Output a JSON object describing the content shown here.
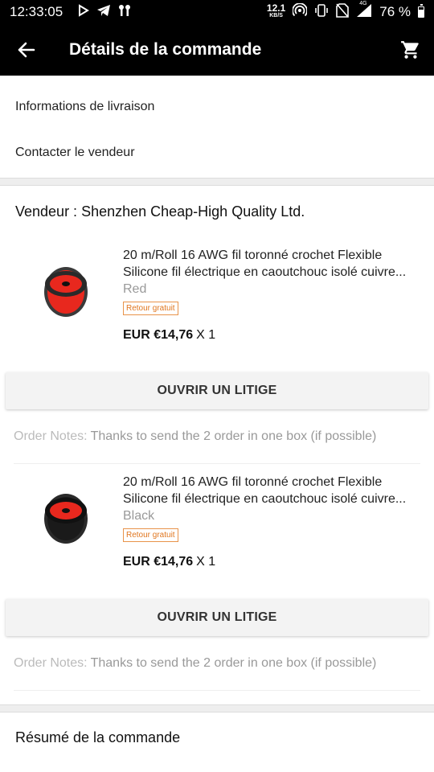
{
  "status_bar": {
    "time": "12:33:05",
    "speed_value": "12.1",
    "speed_unit": "KB/S",
    "network": "4G",
    "battery": "76 %"
  },
  "app_bar": {
    "title": "Détails de la commande"
  },
  "links": {
    "delivery": "Informations de livraison",
    "contact": "Contacter le vendeur"
  },
  "seller": "Vendeur : Shenzhen Cheap-High Quality Ltd.",
  "products": [
    {
      "title_line1": "20 m/Roll 16 AWG fil toronné crochet Flexible",
      "title_line2": "Silicone fil électrique en caoutchouc isolé cuivre...",
      "color": "Red",
      "badge": "Retour gratuit",
      "price": "EUR €14,76",
      "qty": "X 1",
      "button": "OUVRIR UN LITIGE",
      "notes_label": "Order Notes:",
      "notes_text": "Thanks to send the 2 order in one box (if possible)",
      "spool_color": "#e8281e"
    },
    {
      "title_line1": "20 m/Roll 16 AWG fil toronné crochet Flexible",
      "title_line2": "Silicone fil électrique en caoutchouc isolé cuivre...",
      "color": "Black",
      "badge": "Retour gratuit",
      "price": "EUR €14,76",
      "qty": "X 1",
      "button": "OUVRIR UN LITIGE",
      "notes_label": "Order Notes:",
      "notes_text": "Thanks to send the 2 order in one box (if possible)",
      "spool_color": "#1a1a1a"
    }
  ],
  "summary": "Résumé de la commande",
  "colors": {
    "bar": "#000000",
    "badge": "#e0761f",
    "separator": "#eeeeee"
  }
}
